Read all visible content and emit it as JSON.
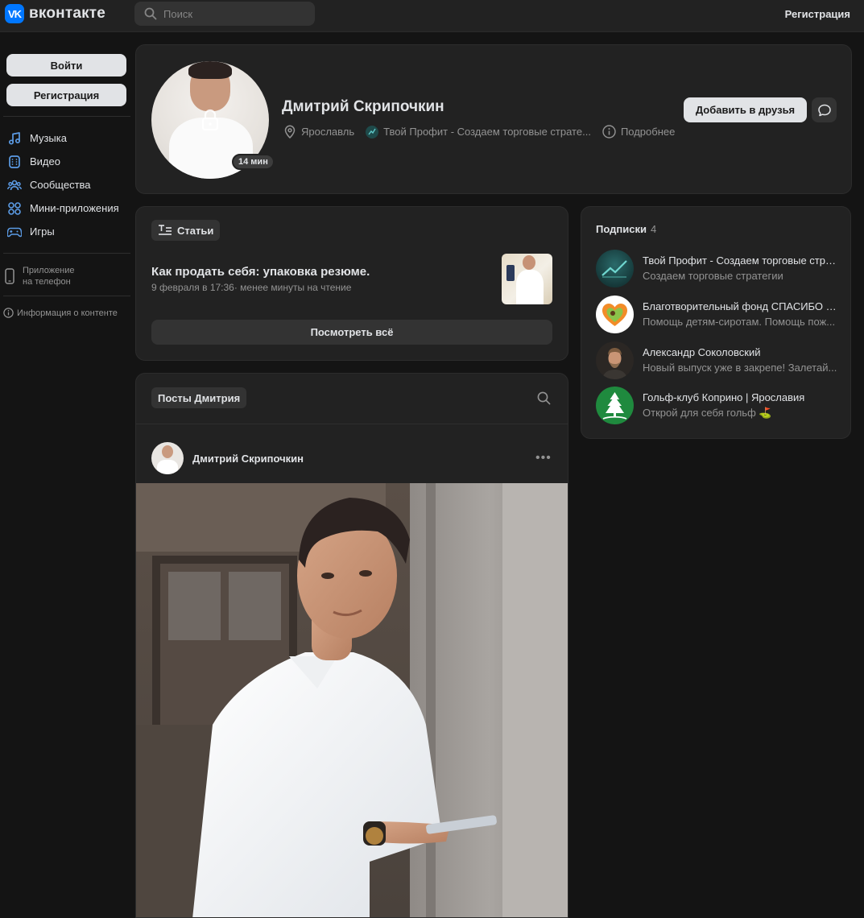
{
  "header": {
    "logo_mark": "VK",
    "logo_text": "вконтакте",
    "search_placeholder": "Поиск",
    "register_link": "Регистрация"
  },
  "sidebar": {
    "login_button": "Войти",
    "register_button": "Регистрация",
    "nav": [
      {
        "label": "Музыка",
        "icon": "music-icon"
      },
      {
        "label": "Видео",
        "icon": "video-icon"
      },
      {
        "label": "Сообщества",
        "icon": "communities-icon"
      },
      {
        "label": "Мини-приложения",
        "icon": "mini-apps-icon"
      },
      {
        "label": "Игры",
        "icon": "games-icon"
      }
    ],
    "app_line1": "Приложение",
    "app_line2": "на телефон",
    "content_info": "Информация о контенте"
  },
  "profile": {
    "name": "Дмитрий Скрипочкин",
    "last_seen_badge": "14 мин",
    "city": "Ярославль",
    "work": "Твой Профит - Создаем торговые страте...",
    "more": "Подробнее",
    "add_friend_button": "Добавить в друзья"
  },
  "articles": {
    "tab_label": "Статьи",
    "title": "Как продать себя: упаковка резюме.",
    "meta": "9 февраля в 17:36· менее минуты на чтение",
    "see_all_button": "Посмотреть всё"
  },
  "subscriptions": {
    "title": "Подписки",
    "count": "4",
    "items": [
      {
        "name": "Твой Профит - Создаем торговые стра...",
        "desc": "Создаем торговые стратегии"
      },
      {
        "name": "Благотворительный фонд СПАСИБО | ...",
        "desc": "Помощь детям-сиротам. Помощь пож..."
      },
      {
        "name": "Александр Соколовский",
        "desc": "Новый выпуск уже в закрепе! Залетай..."
      },
      {
        "name": "Гольф-клуб Коприно | Ярославия",
        "desc": "Открой для себя гольф ⛳"
      }
    ]
  },
  "posts": {
    "tab_label": "Посты Дмитрия",
    "author": "Дмитрий Скрипочкин",
    "more_glyph": "•••"
  },
  "colors": {
    "page_bg": "#141414",
    "card_bg": "#222222",
    "primary_button": "#e1e3e6",
    "secondary_text": "#939393",
    "brand": "#0077ff"
  }
}
